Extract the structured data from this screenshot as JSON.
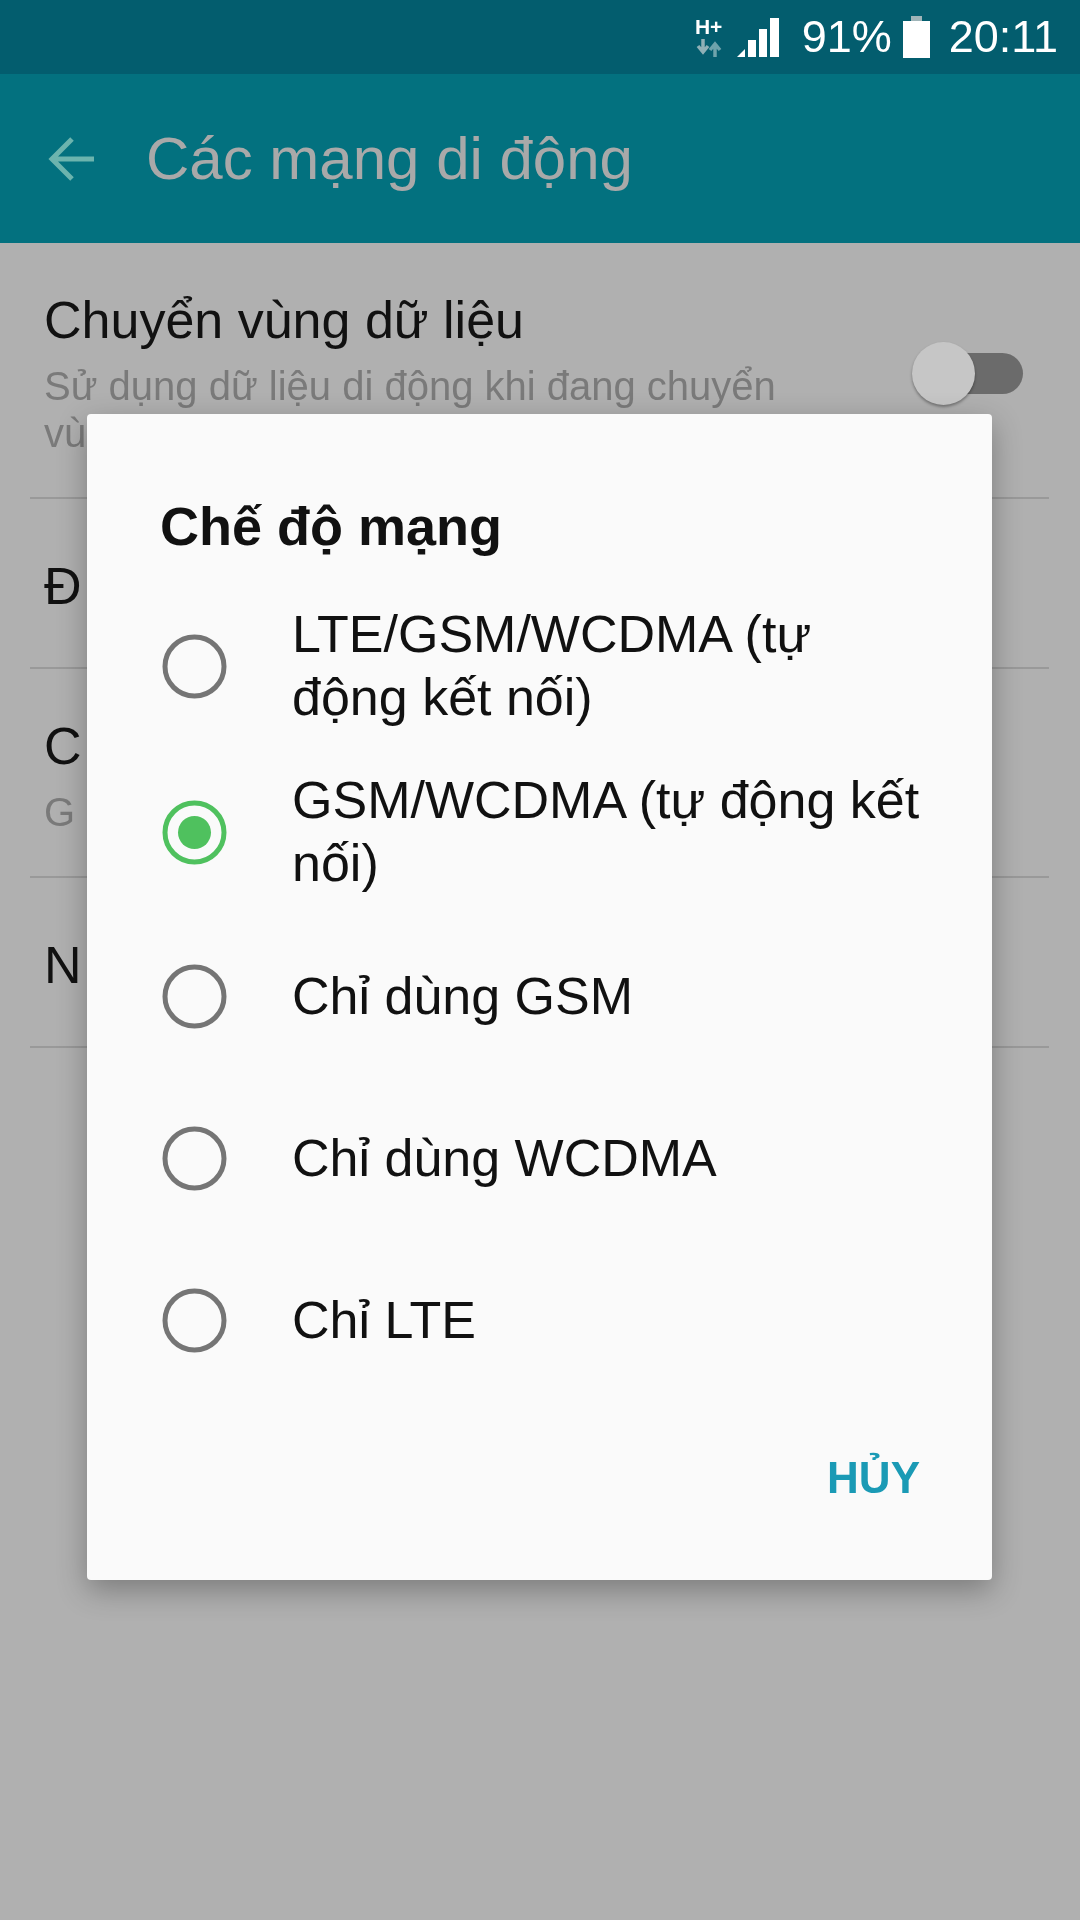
{
  "status_bar": {
    "network_type": "H+",
    "battery": "91%",
    "time": "20:11"
  },
  "app_bar": {
    "title": "Các mạng di động"
  },
  "settings": [
    {
      "kind": "switch",
      "title": "Chuyển vùng dữ liệu",
      "subtitle": "Sử dụng dữ liệu di động khi đang chuyển vù",
      "on": false
    },
    {
      "kind": "text",
      "title": "Đ"
    },
    {
      "kind": "text",
      "title": "C",
      "subtitle": "G"
    },
    {
      "kind": "text",
      "title": "N"
    }
  ],
  "dialog": {
    "title": "Chế độ mạng",
    "options": [
      {
        "label": "LTE/GSM/WCDMA (tự động kết nối)",
        "selected": false
      },
      {
        "label": "GSM/WCDMA (tự động kết nối)",
        "selected": true
      },
      {
        "label": "Chỉ dùng GSM",
        "selected": false
      },
      {
        "label": "Chỉ dùng WCDMA",
        "selected": false
      },
      {
        "label": "Chỉ LTE",
        "selected": false
      }
    ],
    "buttons": [
      "HỦY"
    ]
  }
}
